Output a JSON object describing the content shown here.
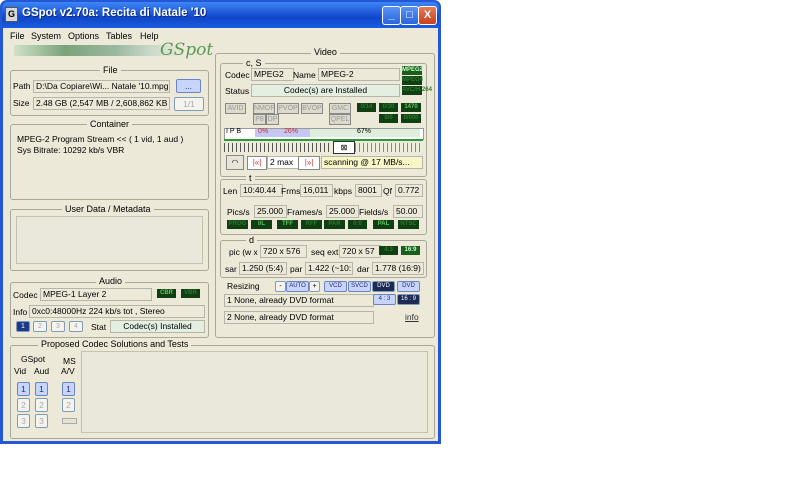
{
  "window": {
    "title": "GSpot v2.70a: Recita di Natale '10",
    "icon_text": "G"
  },
  "title_buttons": {
    "minimize": "_",
    "maximize": "□",
    "close": "X"
  },
  "menu": [
    "File",
    "System",
    "Options",
    "Tables",
    "Help"
  ],
  "logo": "GSpot",
  "file": {
    "group_title": "File",
    "path_label": "Path",
    "path_value": "D:\\Da Copiare\\Wi... Natale '10.mpg",
    "browse_label": "...",
    "size_label": "Size",
    "size_value": "2.48 GB (2,547 MB / 2,608,862 KB",
    "parts_label": "1/1"
  },
  "container": {
    "group_title": "Container",
    "lines": [
      "MPEG-2 Program Stream << ( 1 vid, 1 aud )",
      "Sys Bitrate: 10292 kb/s VBR"
    ]
  },
  "user_data": {
    "group_title": "User Data / Metadata"
  },
  "audio": {
    "group_title": "Audio",
    "codec_label": "Codec",
    "codec_value": "MPEG-1 Layer 2",
    "led_cbr": "CBR",
    "led_vbr": "VBR",
    "info_label": "Info",
    "info_value": "0xc0:48000Hz  224 kb/s tot , Stereo",
    "stream_buttons": [
      "1",
      "2",
      "3",
      "4"
    ],
    "stat_label": "Stat",
    "stat_value": "Codec(s) Installed"
  },
  "video": {
    "group_title": "Video",
    "cs_title": "c, S",
    "codec_label": "Codec",
    "codec_value": "MPEG2",
    "name_label": "Name",
    "name_value": "MPEG-2",
    "leds_right": [
      "MPEG2",
      "MPEG4",
      "AVC/H.264"
    ],
    "status_label": "Status",
    "status_value": "Codec(s) are Installed",
    "flag_buttons_row1": [
      "AVID",
      "NMOP",
      "PVOP",
      "BVOP",
      "QPEL"
    ],
    "flag_buttons_row2": [
      "P8",
      "DP"
    ],
    "flag_right": "GMC",
    "flag_right2": "QPEL",
    "leds_row": [
      "0/14",
      "0/30",
      "1470"
    ],
    "leds_row2": [
      "0/0",
      "0/000"
    ],
    "frame_types": "I P B",
    "pct1": "0%",
    "pct2": "26%",
    "pct3": "67%",
    "nav_label": "2 max",
    "scanning": "scanning @ 17 MB/s...",
    "t_title": "t",
    "len_label": "Len",
    "len_value": "10:40.44",
    "frms_label": "Frms",
    "frms_value": "16,011",
    "kbps_label": "kbps",
    "kbps_value": "8001",
    "qf_label": "Qf",
    "qf_value": "0.772",
    "pics_label": "Pics/s",
    "pics_value": "25.000",
    "frames_label": "Frames/s",
    "frames_value": "25.000",
    "fields_label": "Fields/s",
    "fields_value": "50.00",
    "leds_scan": [
      "PROG",
      "I/L",
      "TFF",
      "RFF",
      "PAR",
      "0:0",
      "PAL",
      "NTSC"
    ],
    "d_title": "d",
    "pic_label": "pic (w x",
    "pic_value": "720 x 576",
    "seq_label": "seq ext",
    "seq_value": "720 x 57",
    "leds_aspect": [
      "4:3",
      "16:9"
    ],
    "sar_label": "sar",
    "sar_value": "1.250 (5:4)",
    "par_label": "par",
    "par_value": "1.422 (~10:",
    "dar_label": "dar",
    "dar_value": "1.778 (16:9)",
    "resizing_label": "Resizing",
    "resize_buttons": [
      "-",
      "AUTO",
      "+",
      "VCD",
      "SVCD",
      "DVD",
      "DVD"
    ],
    "line1": "1  None, already DVD format",
    "line1_buttons": [
      "4 : 3",
      "16 : 9"
    ],
    "line2": "2  None, already DVD format",
    "info_link": "info"
  },
  "proposed": {
    "group_title": "Proposed Codec Solutions and Tests",
    "gspot_label": "GSpot",
    "vid_label": "Vid",
    "aud_label": "Aud",
    "ms_label": "MS",
    "av_label": "A/V",
    "vid_buttons": [
      "1",
      "2",
      "3"
    ],
    "aud_buttons": [
      "1",
      "2",
      "3"
    ],
    "ms_buttons": [
      "1",
      "2"
    ]
  },
  "colors": {
    "title_blue": "#1c56d8",
    "face": "#ece9d8",
    "led_green": "#5dc55d",
    "led_bg": "#0f3f12"
  }
}
